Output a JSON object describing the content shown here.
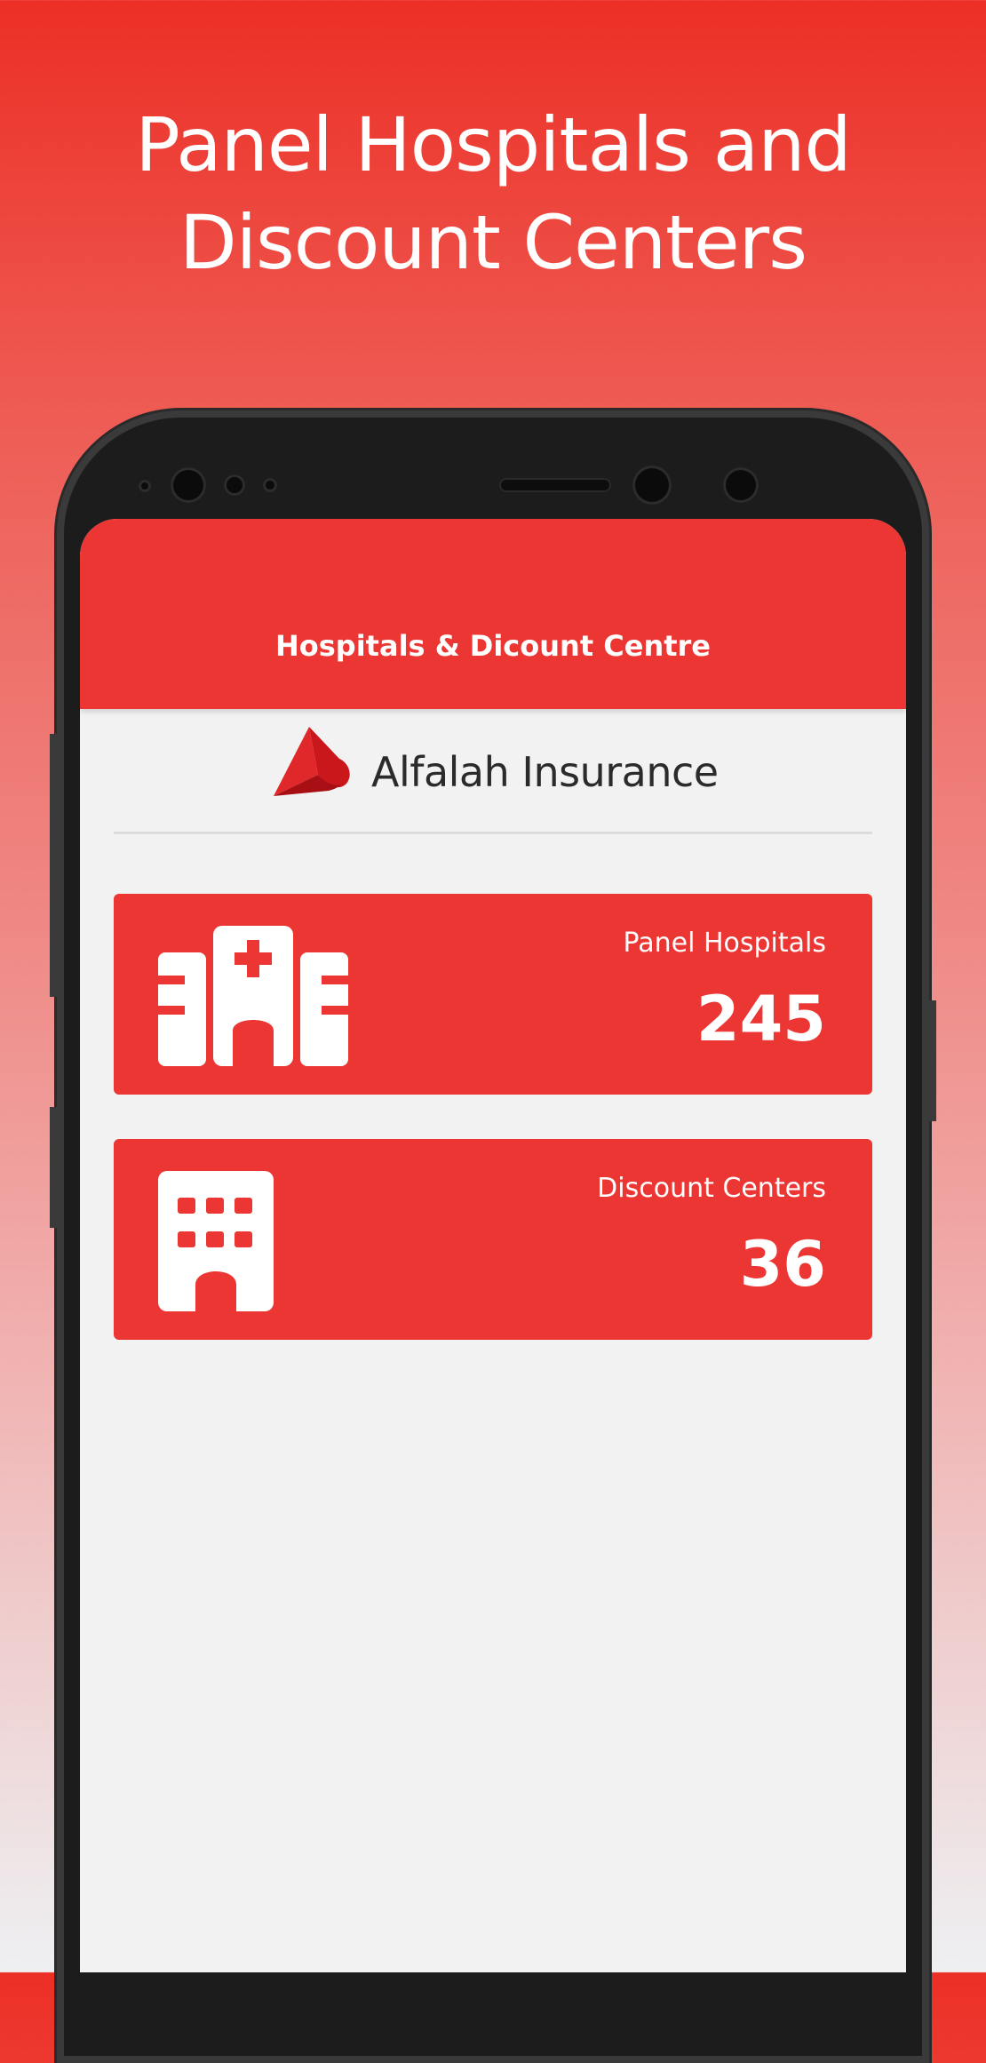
{
  "promo": {
    "title_line1": "Panel Hospitals and",
    "title_line2": "Discount Centers"
  },
  "app_bar": {
    "title": "Hospitals & Dicount Centre"
  },
  "brand": {
    "name": "Alfalah Insurance",
    "logo_icon": "alfalah-logo-icon"
  },
  "cards": [
    {
      "label": "Panel Hospitals",
      "value": "245",
      "icon": "hospital-icon"
    },
    {
      "label": "Discount Centers",
      "value": "36",
      "icon": "office-building-icon"
    }
  ],
  "colors": {
    "accent": "#ec3633",
    "screen_bg": "#f2f2f2",
    "text_dark": "#2b2b2b"
  }
}
